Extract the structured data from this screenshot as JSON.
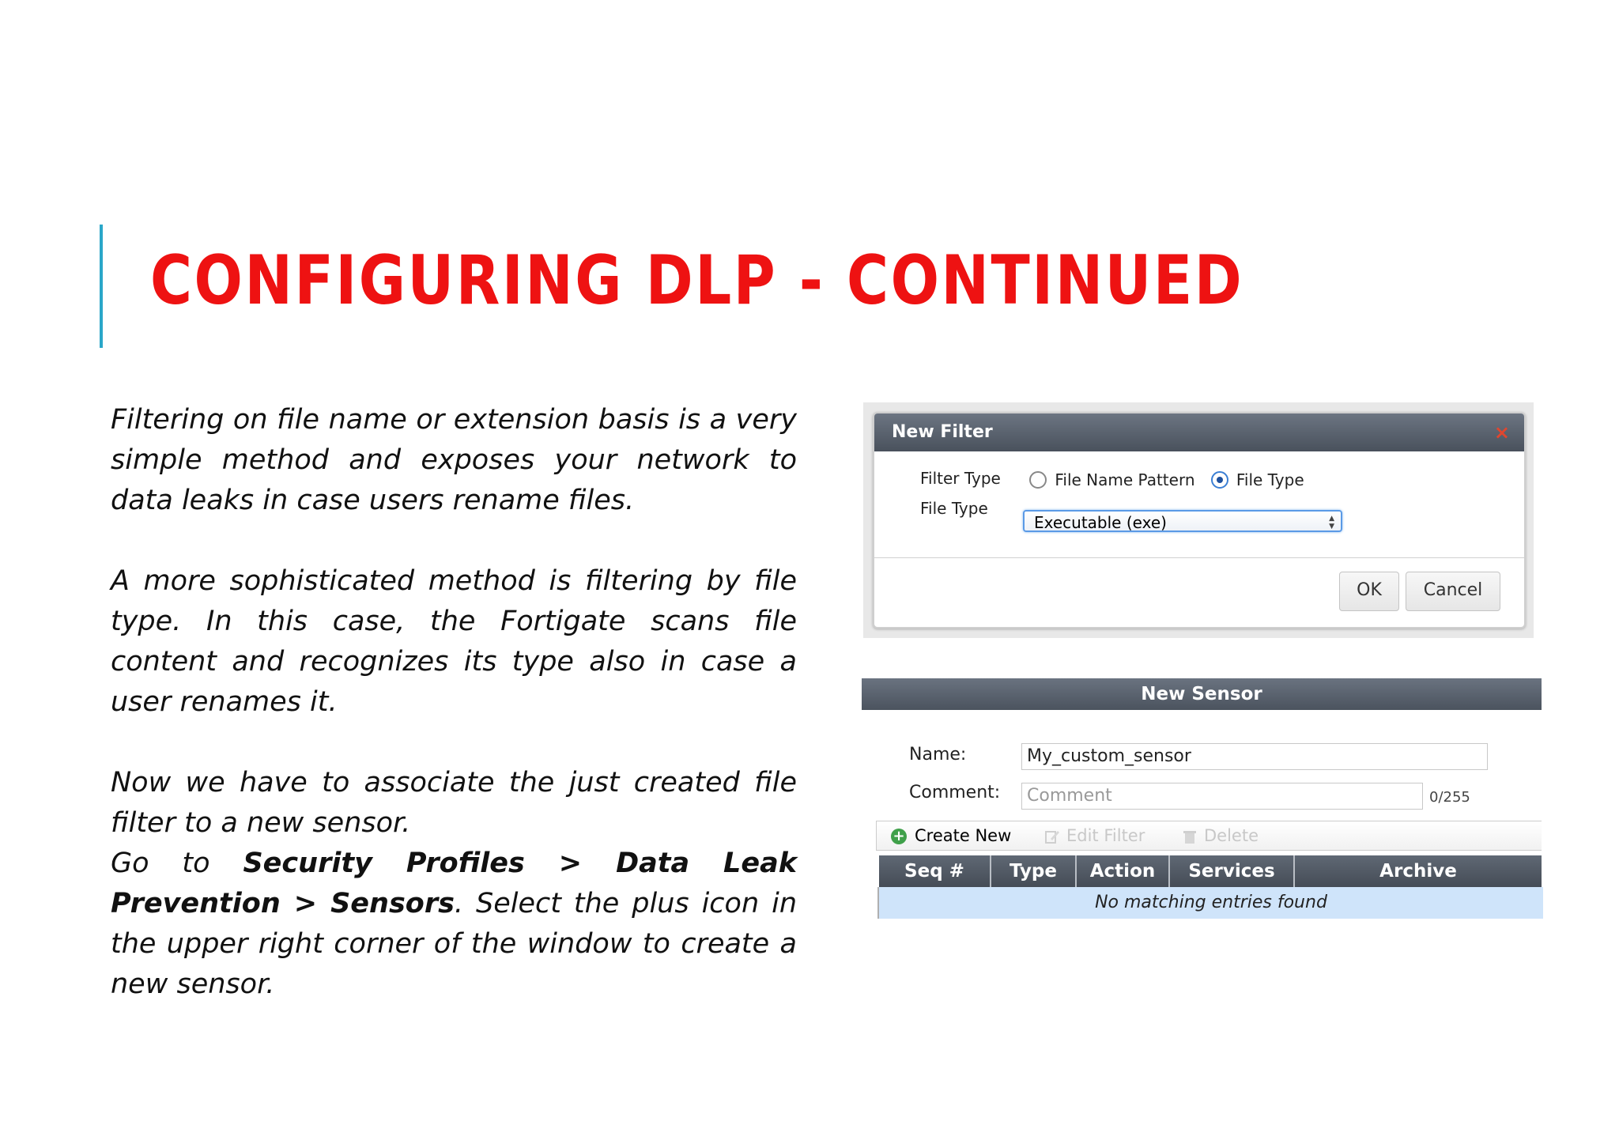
{
  "slide": {
    "title": "CONFIGURING DLP - CONTINUED",
    "paragraph1": "Filtering on file name or extension basis is a very simple method and exposes your network to data leaks in case users rename files.",
    "paragraph2": "A more sophisticated method is filtering by file type. In this case, the Fortigate scans file content and recognizes its type also in case a user renames it.",
    "paragraph3": "Now we have to associate the just created file filter to a new sensor.",
    "p4_go_to": "Go to ",
    "p4_path_1": "Security Profiles",
    "p4_sep_1": " > ",
    "p4_path_2": "Data Leak Prevention",
    "p4_sep_2": " > ",
    "p4_path_3": "Sensors",
    "p4_rest": ". Select the plus icon in the upper right corner of the window to create a new sensor."
  },
  "new_filter_dialog": {
    "title": "New Filter",
    "close_icon": "×",
    "filter_type_label": "Filter Type",
    "options": [
      {
        "label": "File Name Pattern",
        "selected": false
      },
      {
        "label": "File Type",
        "selected": true
      }
    ],
    "file_type_label": "File Type",
    "file_type_value": "Executable (exe)",
    "ok_label": "OK",
    "cancel_label": "Cancel"
  },
  "new_sensor": {
    "title": "New Sensor",
    "name_label": "Name:",
    "name_value": "My_custom_sensor",
    "comment_label": "Comment:",
    "comment_placeholder": "Comment",
    "comment_counter": "0/255",
    "toolbar": {
      "create_new": "Create New",
      "edit_filter": "Edit Filter",
      "delete": "Delete"
    },
    "columns": [
      "Seq #",
      "Type",
      "Action",
      "Services",
      "Archive"
    ],
    "empty_message": "No matching entries found"
  },
  "colors": {
    "title_red": "#ee1212",
    "accent_blue": "#2aa7c9",
    "header_gray": "#545c67",
    "empty_row_blue": "#cfe4fa"
  }
}
